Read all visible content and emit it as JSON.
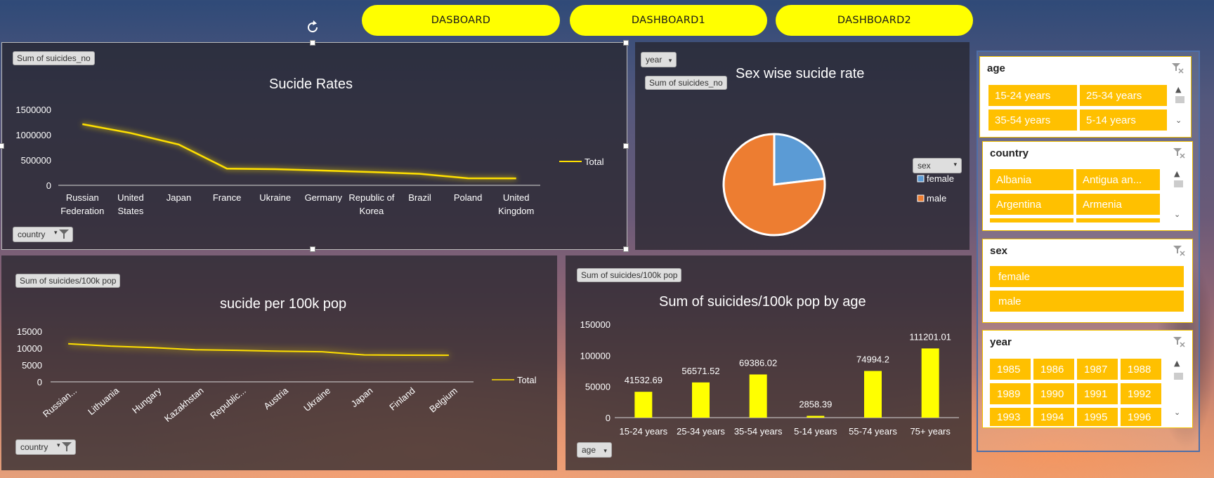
{
  "nav": [
    {
      "label": "DASBOARD"
    },
    {
      "label": "DASHBOARD1"
    },
    {
      "label": "DASHBOARD2"
    }
  ],
  "chart1": {
    "field_value": "Sum of suicides_no",
    "filter_label": "country",
    "chart_data": {
      "type": "line",
      "title": "Sucide Rates",
      "categories": [
        [
          "Russian",
          "Federation"
        ],
        [
          "United",
          "States"
        ],
        [
          "Japan"
        ],
        [
          "France"
        ],
        [
          "Ukraine"
        ],
        [
          "Germany"
        ],
        [
          "Republic of",
          "Korea"
        ],
        [
          "Brazil"
        ],
        [
          "Poland"
        ],
        [
          "United",
          "Kingdom"
        ]
      ],
      "series": [
        {
          "name": "Total",
          "values": [
            1209742,
            1034013,
            806902,
            329127,
            319950,
            291262,
            261730,
            226613,
            139098,
            136805
          ]
        }
      ],
      "yticks": [
        "1500000",
        "1000000",
        "500000",
        "0"
      ],
      "ylim": [
        0,
        1500000
      ],
      "legend": "right",
      "color": "#ffe000"
    }
  },
  "chart2": {
    "year_label": "year",
    "field_value": "Sum of suicides_no",
    "sex_filter": "sex",
    "chart_data": {
      "type": "pie",
      "title": "Sex wise sucide rate",
      "labels": [
        "female",
        "male"
      ],
      "values": [
        1559510,
        5188910
      ],
      "colors": [
        "#5b9bd5",
        "#ed7d31"
      ],
      "legend": "right"
    }
  },
  "chart3": {
    "field_value": "Sum of suicides/100k pop",
    "filter_label": "country",
    "chart_data": {
      "type": "line",
      "title": "sucide per 100k pop",
      "categories": [
        "Russian...",
        "Lithuania",
        "Hungary",
        "Kazakhstan",
        "Republic...",
        "Austria",
        "Ukraine",
        "Japan",
        "Finland",
        "Belgium"
      ],
      "series": [
        {
          "name": "Total",
          "values": [
            11305,
            10589,
            10156,
            9520,
            9350,
            9076,
            8931,
            7987,
            7924,
            7900
          ]
        }
      ],
      "yticks": [
        "15000",
        "10000",
        "5000",
        "0"
      ],
      "ylim": [
        0,
        15000
      ],
      "legend": "right",
      "color": "#ffe000"
    }
  },
  "chart4": {
    "field_value": "Sum of suicides/100k pop",
    "filter_label": "age",
    "chart_data": {
      "type": "bar",
      "title": "Sum of suicides/100k pop by age",
      "categories": [
        "15-24 years",
        "25-34 years",
        "35-54 years",
        "5-14 years",
        "55-74 years",
        "75+ years"
      ],
      "values": [
        41532.69,
        56571.52,
        69386.02,
        2858.39,
        74994.2,
        111201.01
      ],
      "labels": [
        "41532.69",
        "56571.52",
        "69386.02",
        "2858.39",
        "74994.2",
        "111201.01"
      ],
      "yticks": [
        "150000",
        "100000",
        "50000",
        "0"
      ],
      "ylim": [
        0,
        150000
      ],
      "color": "#ffff00"
    }
  },
  "slicers": {
    "age": {
      "title": "age",
      "items": [
        "15-24 years",
        "25-34 years",
        "35-54 years",
        "5-14 years"
      ]
    },
    "country": {
      "title": "country",
      "items": [
        "Albania",
        "Antigua an...",
        "Argentina",
        "Armenia"
      ]
    },
    "sex": {
      "title": "sex",
      "items": [
        "female",
        "male"
      ]
    },
    "year": {
      "title": "year",
      "items": [
        "1985",
        "1986",
        "1987",
        "1988",
        "1989",
        "1990",
        "1991",
        "1992",
        "1993",
        "1994",
        "1995",
        "1996"
      ]
    }
  },
  "icons": {
    "refresh": "rotate-icon",
    "clear_filter": "clear-filter-icon",
    "dropdown": "dropdown-arrow-icon",
    "filter": "filter-icon"
  }
}
